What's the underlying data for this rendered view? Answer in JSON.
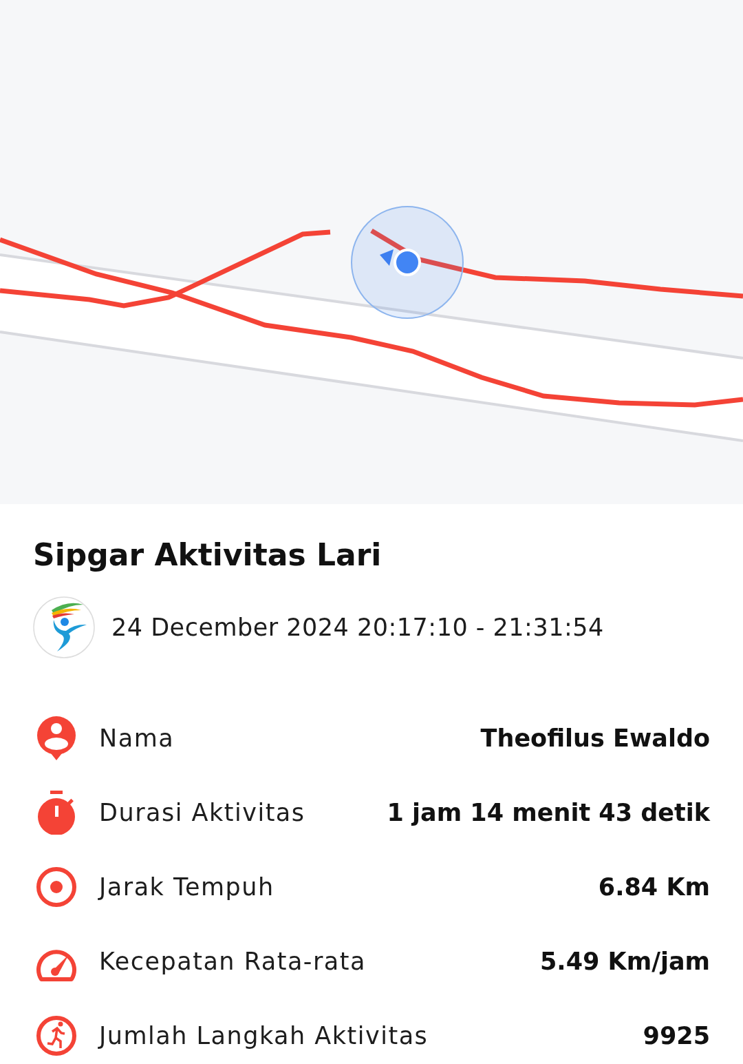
{
  "title": "Sipgar Aktivitas Lari",
  "date": "24 December 2024 20:17:10 - 21:31:54",
  "stats": [
    {
      "kind": "person",
      "label": "Nama",
      "value": "Theofilus Ewaldo"
    },
    {
      "kind": "stopwatch",
      "label": "Durasi Aktivitas",
      "value": "1 jam 14 menit 43 detik"
    },
    {
      "kind": "target",
      "label": "Jarak Tempuh",
      "value": "6.84 Km"
    },
    {
      "kind": "speed",
      "label": "Kecepatan Rata-rata",
      "value": "5.49 Km/jam"
    },
    {
      "kind": "run",
      "label": "Jumlah Langkah Aktivitas",
      "value": "9925"
    }
  ]
}
